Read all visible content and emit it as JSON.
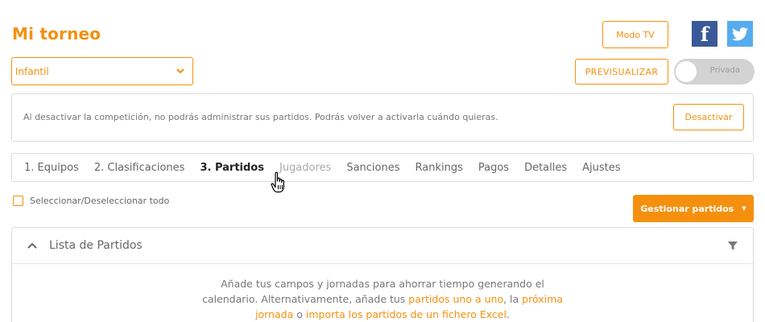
{
  "header": {
    "title": "Mi torneo",
    "modo_tv": "Modo TV",
    "facebook_glyph": "f",
    "twitter_glyph": "🐦"
  },
  "controls": {
    "category": "Infantil",
    "preview": "PREVISUALIZAR",
    "privacy": "Privada"
  },
  "notice": {
    "text": "Al desactivar la competición, no podrás administrar sus partidos. Podrás volver a activarla cuándo quieras.",
    "button": "Desactivar"
  },
  "tabs": [
    {
      "label": "1. Equipos"
    },
    {
      "label": "2. Clasificaciones"
    },
    {
      "label": "3. Partidos"
    },
    {
      "label": "Jugadores"
    },
    {
      "label": "Sanciones"
    },
    {
      "label": "Rankings"
    },
    {
      "label": "Pagos"
    },
    {
      "label": "Detalles"
    },
    {
      "label": "Ajustes"
    }
  ],
  "selection": {
    "select_all": "Seleccionar/Deseleccionar todo",
    "manage": "Gestionar partidos"
  },
  "list": {
    "title": "Lista de Partidos",
    "empty": {
      "line1": "Añade tus campos y jornadas para ahorrar tiempo generando el",
      "line2_pre": "calendario. Alternativamente, añade tus ",
      "link1": "partidos uno a uno",
      "mid": ", la ",
      "link2a": "próxima",
      "link2b": "jornada",
      "sep": " o ",
      "link3": "importa los partidos de un fichero Excel",
      "end": "."
    }
  },
  "colors": {
    "accent": "#f5900f",
    "facebook": "#3b5998",
    "twitter": "#55acee"
  }
}
